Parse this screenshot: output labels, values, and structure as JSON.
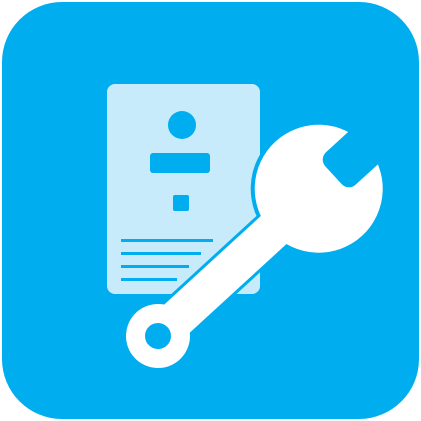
{
  "icon": {
    "name": "document-wrench-app-icon",
    "colors": {
      "tile": "#00AEEF",
      "document": "#C7EBFB",
      "document_marks": "#00AEEF",
      "wrench": "#FFFFFF"
    }
  }
}
